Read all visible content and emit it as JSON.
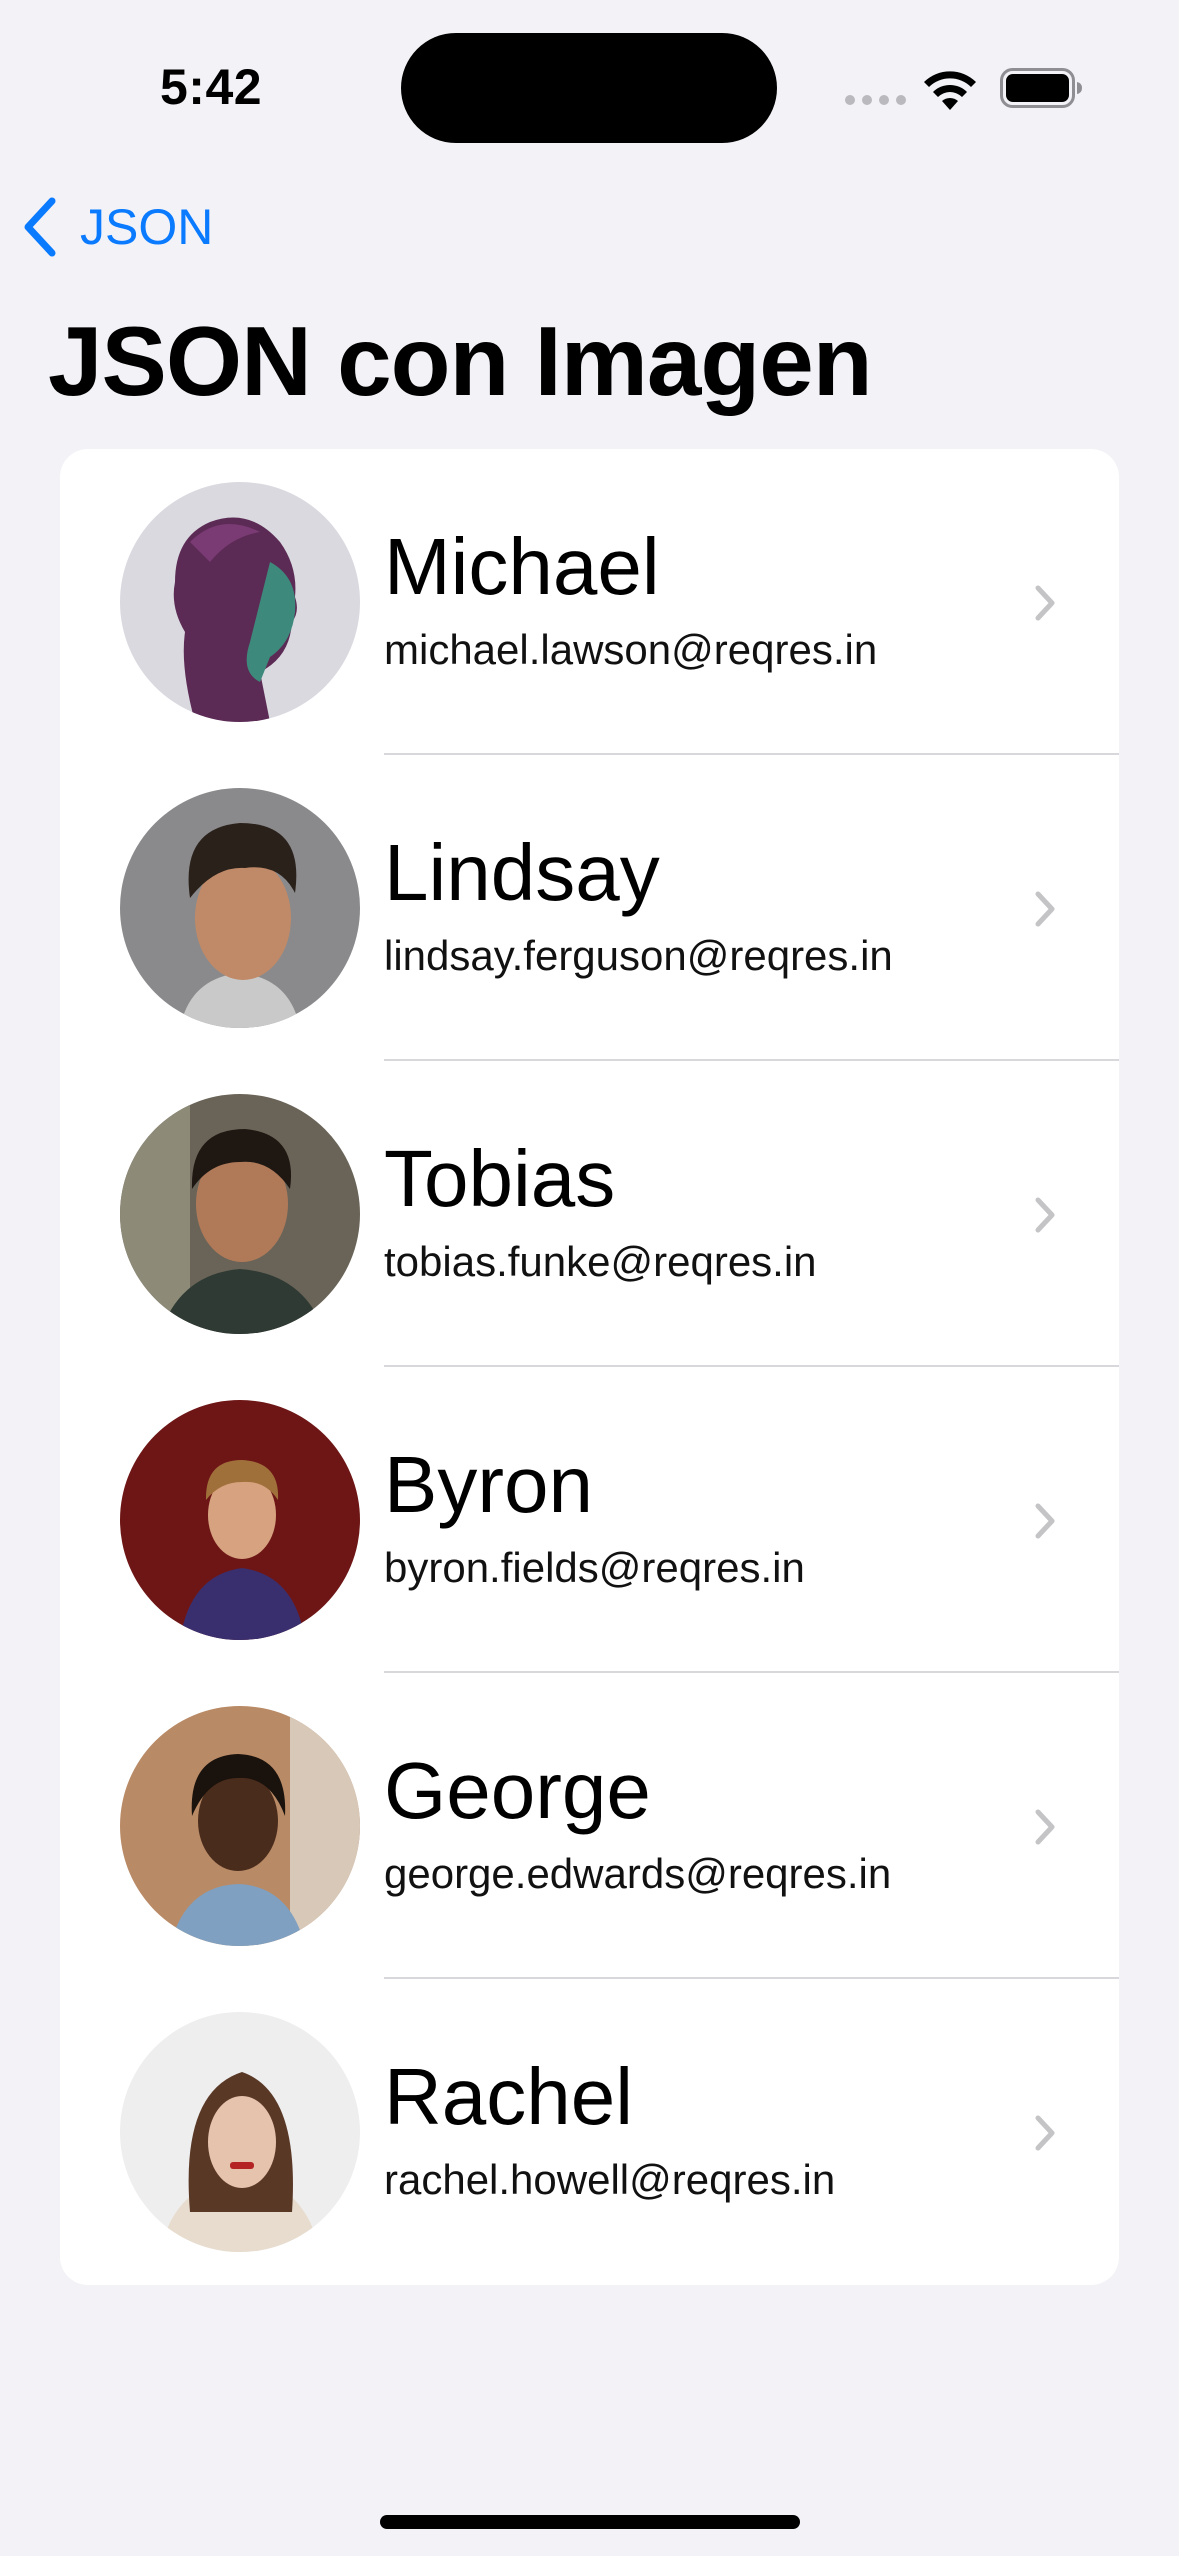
{
  "status_bar": {
    "time": "5:42"
  },
  "nav": {
    "back_label": "JSON",
    "title": "JSON con Imagen"
  },
  "users": [
    {
      "name": "Michael",
      "email": "michael.lawson@reqres.in"
    },
    {
      "name": "Lindsay",
      "email": "lindsay.ferguson@reqres.in"
    },
    {
      "name": "Tobias",
      "email": "tobias.funke@reqres.in"
    },
    {
      "name": "Byron",
      "email": "byron.fields@reqres.in"
    },
    {
      "name": "George",
      "email": "george.edwards@reqres.in"
    },
    {
      "name": "Rachel",
      "email": "rachel.howell@reqres.in"
    }
  ],
  "colors": {
    "accent": "#0a7aff",
    "background": "#f2f2f7",
    "card": "#ffffff",
    "chevron": "#c4c4c7"
  },
  "icons": {
    "back": "chevron-left-icon",
    "row_disclosure": "chevron-right-icon"
  }
}
